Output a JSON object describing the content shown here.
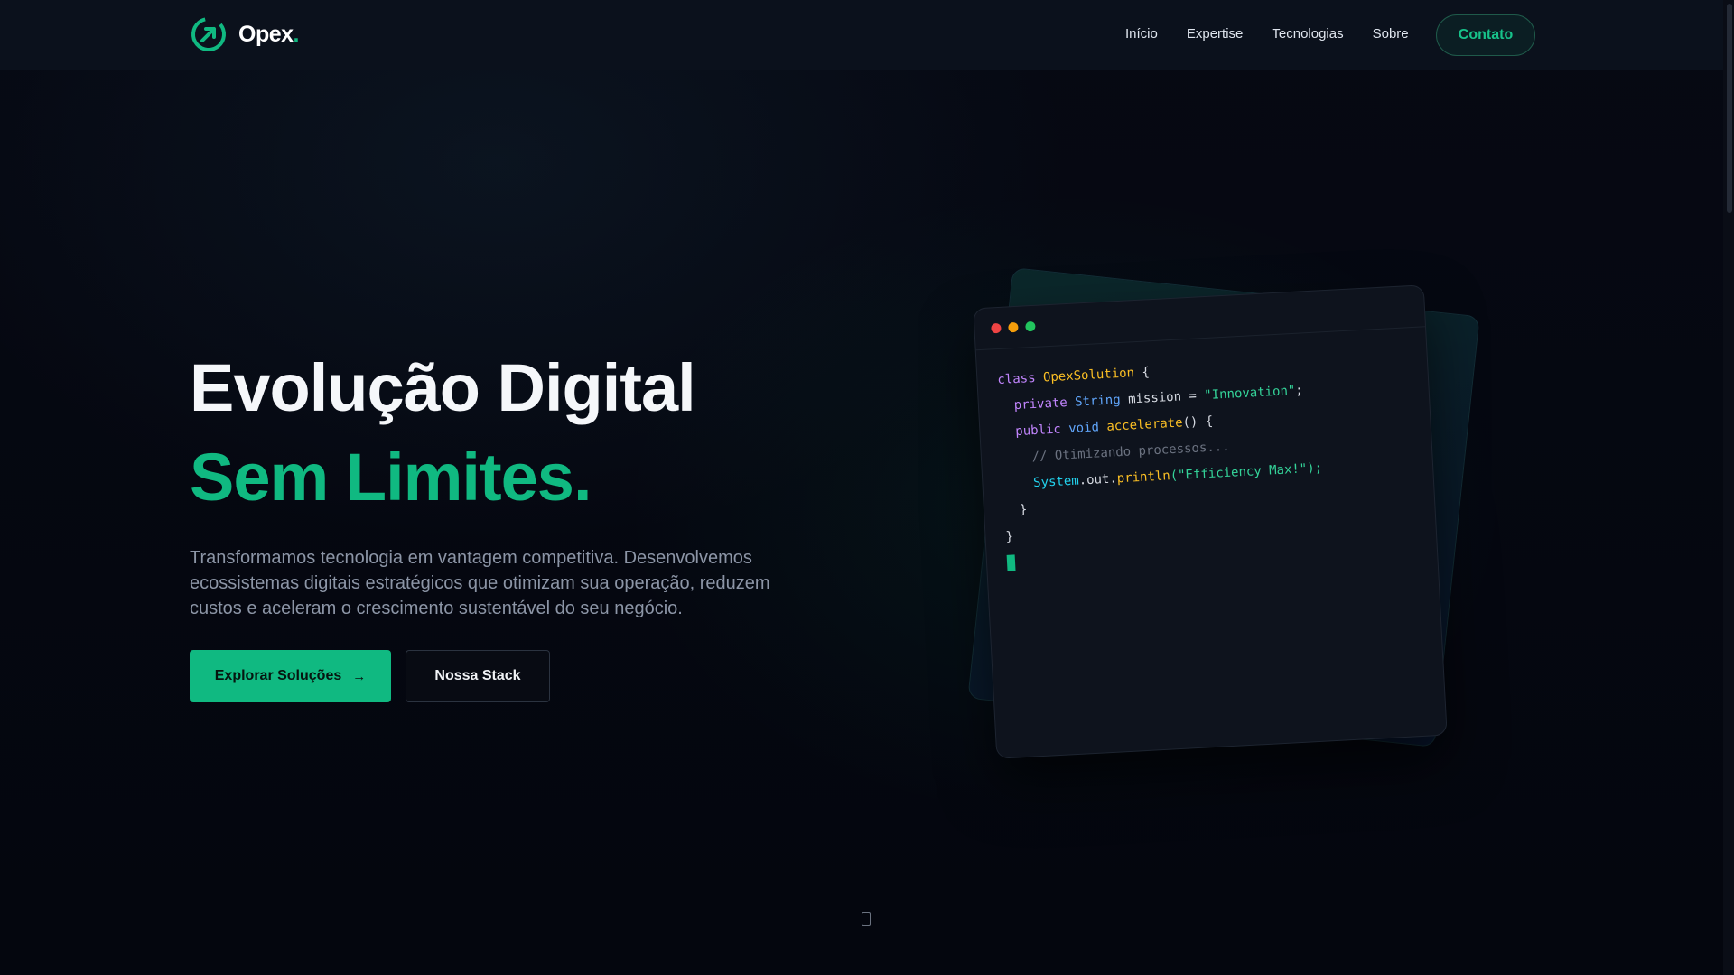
{
  "brand": {
    "name": "Opex",
    "dot": "."
  },
  "nav": {
    "items": [
      "Início",
      "Expertise",
      "Tecnologias",
      "Sobre"
    ],
    "cta": "Contato"
  },
  "hero": {
    "title_line1": "Evolução Digital",
    "title_line2": "Sem Limites.",
    "description": "Transformamos tecnologia em vantagem competitiva. Desenvolvemos ecossistemas digitais estratégicos que otimizam sua operação, reduzem custos e aceleram o crescimento sustentável do seu negócio.",
    "primary_button": "Explorar Soluções",
    "secondary_button": "Nossa Stack"
  },
  "code": {
    "l1_kw": "class",
    "l1_cls": "OpexSolution",
    "l1_brace": "{",
    "l2_kw": "private",
    "l2_type": "String",
    "l2_var": "mission",
    "l2_eq": "=",
    "l2_str": "\"Innovation\"",
    "l2_end": ";",
    "l3_kw": "public",
    "l3_type": "void",
    "l3_fn": "accelerate",
    "l3_end": "() {",
    "l4_comment": "// Otimizando processos...",
    "l5_obj": "System",
    "l5_dot": ".out.",
    "l5_fn": "println",
    "l5_str": "(\"Efficiency Max!\");",
    "l6": "}",
    "l7": "}"
  },
  "colors": {
    "accent": "#10b981",
    "background": "#05070f",
    "card": "#0e131d"
  }
}
